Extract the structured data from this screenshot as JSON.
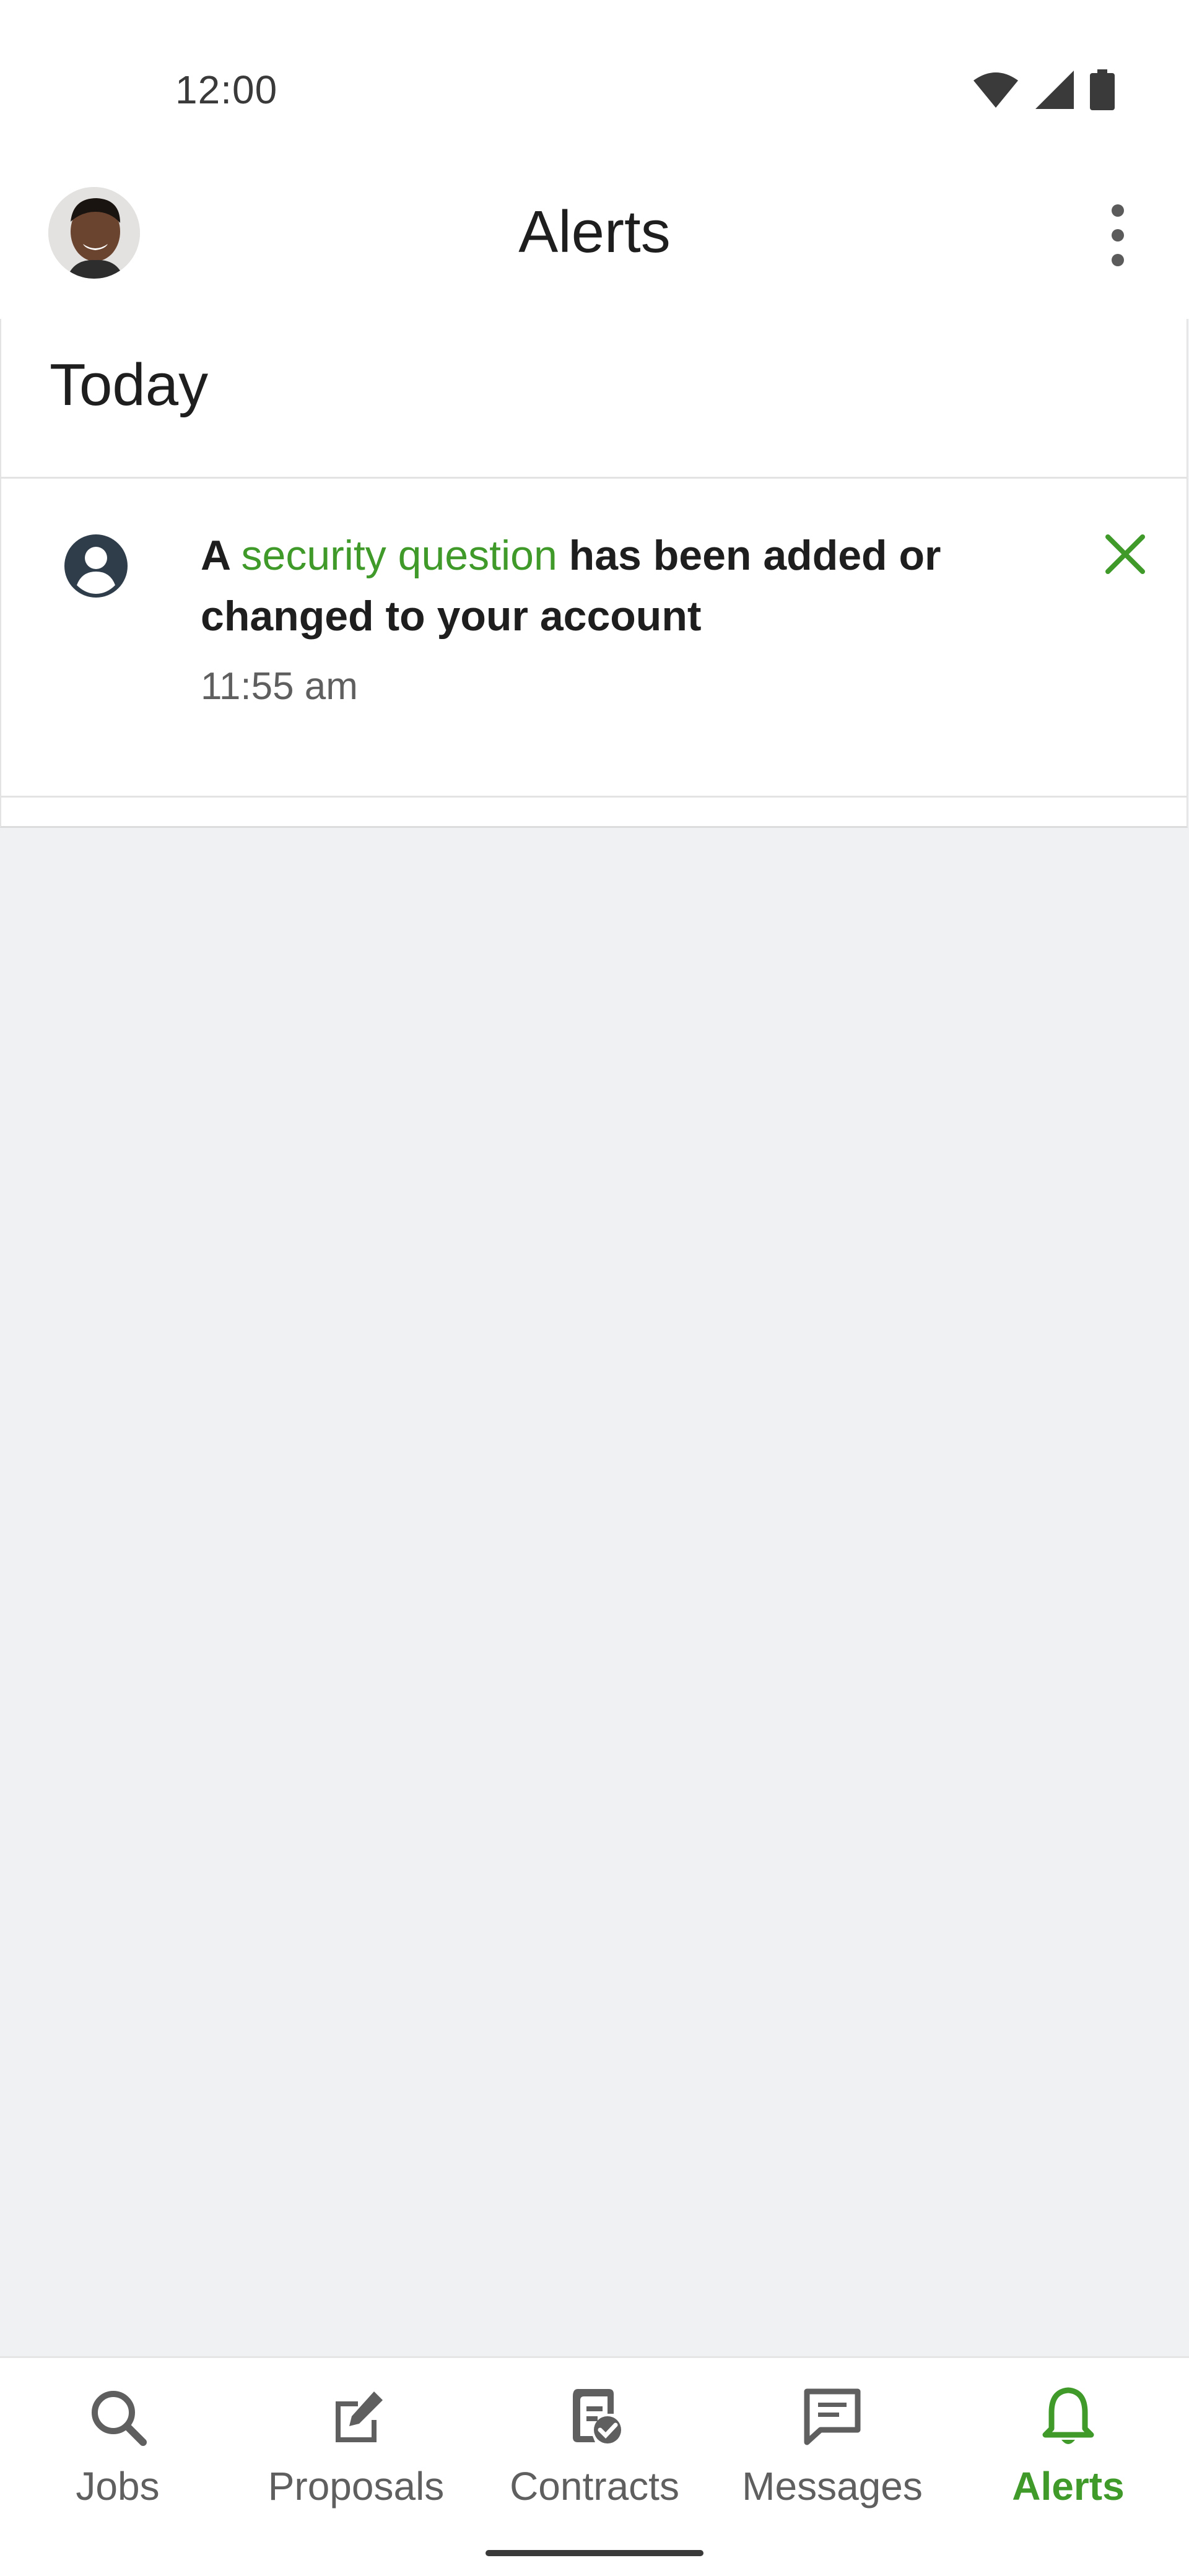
{
  "status_bar": {
    "time": "12:00",
    "icons": [
      "wifi-icon",
      "signal-icon",
      "battery-icon"
    ]
  },
  "app_bar": {
    "title": "Alerts",
    "avatar": "avatar",
    "menu_icon": "more-vert-icon"
  },
  "section": {
    "title": "Today"
  },
  "alerts": [
    {
      "icon": "account-circle-icon",
      "prefix": "A",
      "link_text": "security question",
      "suffix": "has been added or changed to your account",
      "time": "11:55 am",
      "dismiss_icon": "close-icon"
    }
  ],
  "bottom_nav": [
    {
      "label": "Jobs",
      "icon": "search-icon",
      "active": false
    },
    {
      "label": "Proposals",
      "icon": "edit-icon",
      "active": false
    },
    {
      "label": "Contracts",
      "icon": "contract-icon",
      "active": false
    },
    {
      "label": "Messages",
      "icon": "message-icon",
      "active": false
    },
    {
      "label": "Alerts",
      "icon": "bell-icon",
      "active": true
    }
  ],
  "colors": {
    "accent": "#3f9a2a",
    "background": "#f0f1f3",
    "text": "#1e1e1e",
    "muted": "#5f5f5f"
  }
}
